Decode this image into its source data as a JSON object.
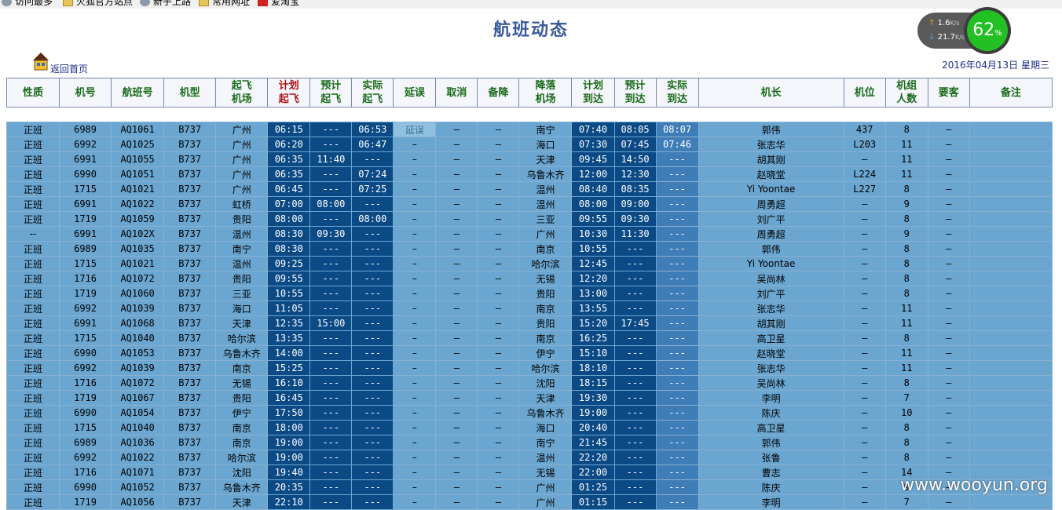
{
  "bookmarks": [
    {
      "label": "访问最多",
      "icon": "gear-icon"
    },
    {
      "label": "火狐官方站点",
      "icon": "folder-icon"
    },
    {
      "label": "新手上路",
      "icon": "globe-icon"
    },
    {
      "label": "常用网址",
      "icon": "folder-icon"
    },
    {
      "label": "爱淘宝",
      "icon": "taobao-icon"
    }
  ],
  "page": {
    "title": "航班动态",
    "home_link": "返回首页",
    "date": "2016年04月13日 星期三"
  },
  "speed": {
    "up": "1.6",
    "up_unit": "K/s",
    "down": "21.7",
    "down_unit": "K/s",
    "percent": "62",
    "percent_sign": "%"
  },
  "columns": [
    "性质",
    "机号",
    "航班号",
    "机型",
    "起飞\n机场",
    "计划\n起飞",
    "预计\n起飞",
    "实际\n起飞",
    "延误",
    "取消",
    "备降",
    "降落\n机场",
    "计划\n到达",
    "预计\n到达",
    "实际\n到达",
    "机长",
    "机位",
    "机组\n人数",
    "要客",
    "备注"
  ],
  "rows": [
    [
      "正班",
      "6989",
      "AQ1061",
      "B737",
      "广州",
      "06:15",
      "---",
      "06:53",
      "延误",
      "–",
      "–",
      "南宁",
      "07:40",
      "08:05",
      "08:07",
      "郭伟",
      "437",
      "8",
      "–",
      ""
    ],
    [
      "正班",
      "6992",
      "AQ1025",
      "B737",
      "广州",
      "06:20",
      "---",
      "06:47",
      "–",
      "–",
      "–",
      "海口",
      "07:30",
      "07:45",
      "07:46",
      "张志华",
      "L203",
      "11",
      "–",
      ""
    ],
    [
      "正班",
      "6991",
      "AQ1055",
      "B737",
      "广州",
      "06:35",
      "11:40",
      "---",
      "–",
      "–",
      "–",
      "天津",
      "09:45",
      "14:50",
      "---",
      "胡其刚",
      "–",
      "11",
      "–",
      ""
    ],
    [
      "正班",
      "6990",
      "AQ1051",
      "B737",
      "广州",
      "06:35",
      "---",
      "07:24",
      "–",
      "–",
      "–",
      "乌鲁木齐",
      "12:00",
      "12:30",
      "---",
      "赵晓堂",
      "L224",
      "11",
      "–",
      ""
    ],
    [
      "正班",
      "1715",
      "AQ1021",
      "B737",
      "广州",
      "06:45",
      "---",
      "07:25",
      "–",
      "–",
      "–",
      "温州",
      "08:40",
      "08:35",
      "---",
      "Yi Yoontae",
      "L227",
      "8",
      "–",
      ""
    ],
    [
      "正班",
      "6991",
      "AQ1022",
      "B737",
      "虹桥",
      "07:00",
      "08:00",
      "---",
      "–",
      "–",
      "–",
      "温州",
      "08:00",
      "09:00",
      "---",
      "周勇超",
      "–",
      "9",
      "–",
      ""
    ],
    [
      "正班",
      "1719",
      "AQ1059",
      "B737",
      "贵阳",
      "08:00",
      "---",
      "08:00",
      "–",
      "–",
      "–",
      "三亚",
      "09:55",
      "09:30",
      "---",
      "刘广平",
      "–",
      "8",
      "–",
      ""
    ],
    [
      "--",
      "6991",
      "AQ102X",
      "B737",
      "温州",
      "08:30",
      "09:30",
      "---",
      "–",
      "–",
      "–",
      "广州",
      "10:30",
      "11:30",
      "---",
      "周勇超",
      "–",
      "9",
      "–",
      ""
    ],
    [
      "正班",
      "6989",
      "AQ1035",
      "B737",
      "南宁",
      "08:30",
      "---",
      "---",
      "–",
      "–",
      "–",
      "南京",
      "10:55",
      "---",
      "---",
      "郭伟",
      "–",
      "8",
      "–",
      ""
    ],
    [
      "正班",
      "1715",
      "AQ1021",
      "B737",
      "温州",
      "09:25",
      "---",
      "---",
      "–",
      "–",
      "–",
      "哈尔滨",
      "12:45",
      "---",
      "---",
      "Yi Yoontae",
      "–",
      "8",
      "–",
      ""
    ],
    [
      "正班",
      "1716",
      "AQ1072",
      "B737",
      "贵阳",
      "09:55",
      "---",
      "---",
      "–",
      "–",
      "–",
      "无锡",
      "12:20",
      "---",
      "---",
      "吴尚林",
      "–",
      "8",
      "–",
      ""
    ],
    [
      "正班",
      "1719",
      "AQ1060",
      "B737",
      "三亚",
      "10:55",
      "---",
      "---",
      "–",
      "–",
      "–",
      "贵阳",
      "13:00",
      "---",
      "---",
      "刘广平",
      "–",
      "8",
      "–",
      ""
    ],
    [
      "正班",
      "6992",
      "AQ1039",
      "B737",
      "海口",
      "11:05",
      "---",
      "---",
      "–",
      "–",
      "–",
      "南京",
      "13:55",
      "---",
      "---",
      "张志华",
      "–",
      "11",
      "–",
      ""
    ],
    [
      "正班",
      "6991",
      "AQ1068",
      "B737",
      "天津",
      "12:35",
      "15:00",
      "---",
      "–",
      "–",
      "–",
      "贵阳",
      "15:20",
      "17:45",
      "---",
      "胡其刚",
      "–",
      "11",
      "–",
      ""
    ],
    [
      "正班",
      "1715",
      "AQ1040",
      "B737",
      "哈尔滨",
      "13:35",
      "---",
      "---",
      "–",
      "–",
      "–",
      "南京",
      "16:25",
      "---",
      "---",
      "高卫星",
      "–",
      "8",
      "–",
      ""
    ],
    [
      "正班",
      "6990",
      "AQ1053",
      "B737",
      "乌鲁木齐",
      "14:00",
      "---",
      "---",
      "–",
      "–",
      "–",
      "伊宁",
      "15:10",
      "---",
      "---",
      "赵晓堂",
      "–",
      "11",
      "–",
      ""
    ],
    [
      "正班",
      "6992",
      "AQ1039",
      "B737",
      "南京",
      "15:25",
      "---",
      "---",
      "–",
      "–",
      "–",
      "哈尔滨",
      "18:10",
      "---",
      "---",
      "张志华",
      "–",
      "11",
      "–",
      ""
    ],
    [
      "正班",
      "1716",
      "AQ1072",
      "B737",
      "无锡",
      "16:10",
      "---",
      "---",
      "–",
      "–",
      "–",
      "沈阳",
      "18:15",
      "---",
      "---",
      "吴尚林",
      "–",
      "8",
      "–",
      ""
    ],
    [
      "正班",
      "1719",
      "AQ1067",
      "B737",
      "贵阳",
      "16:45",
      "---",
      "---",
      "–",
      "–",
      "–",
      "天津",
      "19:30",
      "---",
      "---",
      "李明",
      "–",
      "7",
      "–",
      ""
    ],
    [
      "正班",
      "6990",
      "AQ1054",
      "B737",
      "伊宁",
      "17:50",
      "---",
      "---",
      "–",
      "–",
      "–",
      "乌鲁木齐",
      "19:00",
      "---",
      "---",
      "陈庆",
      "–",
      "10",
      "–",
      ""
    ],
    [
      "正班",
      "1715",
      "AQ1040",
      "B737",
      "南京",
      "18:00",
      "---",
      "---",
      "–",
      "–",
      "–",
      "海口",
      "20:40",
      "---",
      "---",
      "高卫星",
      "–",
      "8",
      "–",
      ""
    ],
    [
      "正班",
      "6989",
      "AQ1036",
      "B737",
      "南京",
      "19:00",
      "---",
      "---",
      "–",
      "–",
      "–",
      "南宁",
      "21:45",
      "---",
      "---",
      "郭伟",
      "–",
      "8",
      "–",
      ""
    ],
    [
      "正班",
      "6992",
      "AQ1022",
      "B737",
      "哈尔滨",
      "19:00",
      "---",
      "---",
      "–",
      "–",
      "–",
      "温州",
      "22:20",
      "---",
      "---",
      "张鲁",
      "–",
      "8",
      "–",
      ""
    ],
    [
      "正班",
      "1716",
      "AQ1071",
      "B737",
      "沈阳",
      "19:40",
      "---",
      "---",
      "–",
      "–",
      "–",
      "无锡",
      "22:00",
      "---",
      "---",
      "曹志",
      "–",
      "14",
      "–",
      ""
    ],
    [
      "正班",
      "6990",
      "AQ1052",
      "B737",
      "乌鲁木齐",
      "20:35",
      "---",
      "---",
      "–",
      "–",
      "–",
      "广州",
      "01:25",
      "---",
      "---",
      "陈庆",
      "–",
      "9",
      "–",
      ""
    ],
    [
      "正班",
      "1719",
      "AQ1056",
      "B737",
      "天津",
      "22:10",
      "---",
      "---",
      "–",
      "–",
      "–",
      "广州",
      "01:15",
      "---",
      "---",
      "李明",
      "–",
      "7",
      "–",
      ""
    ]
  ],
  "watermark": "www.wooyun.org"
}
